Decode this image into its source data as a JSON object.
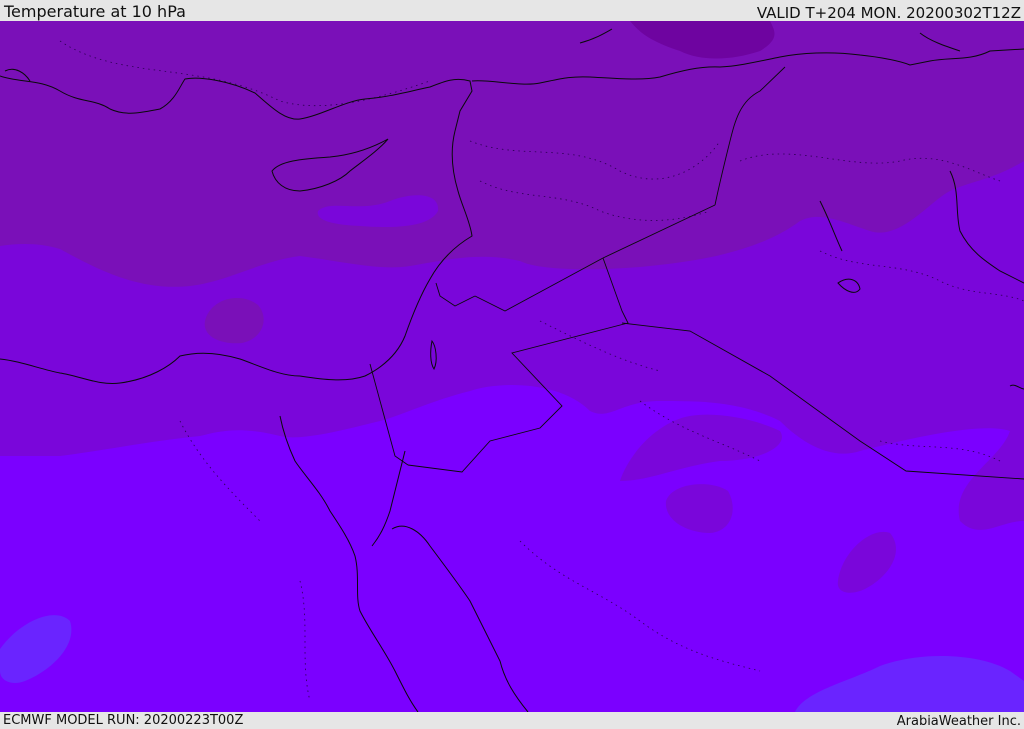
{
  "header": {
    "title": "Temperature at 10 hPa",
    "valid": "VALID T+204 MON. 20200302T12Z"
  },
  "footer": {
    "model_run": "ECMWF MODEL RUN: 20200223T00Z",
    "credit": "ArabiaWeather Inc."
  },
  "colors": {
    "band_dark": "#7a10b8",
    "band_mid": "#7a06da",
    "band_light": "#7b00ff",
    "band_blue": "#6a24ff",
    "blob_deep": "#6e04a0",
    "coastline": "#0a0a0a"
  }
}
